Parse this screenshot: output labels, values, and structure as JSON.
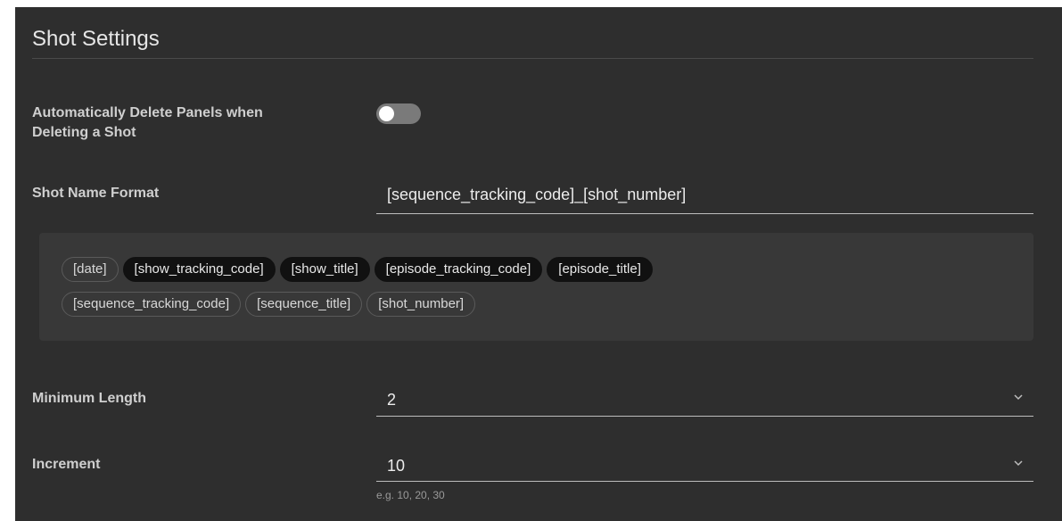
{
  "section": {
    "title": "Shot Settings"
  },
  "auto_delete": {
    "label_line1": "Automatically Delete Panels when",
    "label_line2": "Deleting a Shot",
    "enabled": false
  },
  "shot_name_format": {
    "label": "Shot Name Format",
    "value": "[sequence_tracking_code]_[shot_number]"
  },
  "tokens": {
    "row1": [
      {
        "label": "[date]",
        "style": "outlined"
      },
      {
        "label": "[show_tracking_code]",
        "style": "filled"
      },
      {
        "label": "[show_title]",
        "style": "filled"
      },
      {
        "label": "[episode_tracking_code]",
        "style": "filled"
      },
      {
        "label": "[episode_title]",
        "style": "filled"
      }
    ],
    "row2": [
      {
        "label": "[sequence_tracking_code]",
        "style": "outlined"
      },
      {
        "label": "[sequence_title]",
        "style": "outlined"
      },
      {
        "label": "[shot_number]",
        "style": "outlined"
      }
    ]
  },
  "minimum_length": {
    "label": "Minimum Length",
    "value": "2",
    "icon": "chevron-down-icon"
  },
  "increment": {
    "label": "Increment",
    "value": "10",
    "hint": "e.g. 10, 20, 30",
    "icon": "chevron-down-icon"
  },
  "colors": {
    "panel_bg": "#2e2e2e",
    "token_area_bg": "#383838",
    "filled_token_bg": "#111111",
    "toggle_off": "#7a7a7a"
  }
}
